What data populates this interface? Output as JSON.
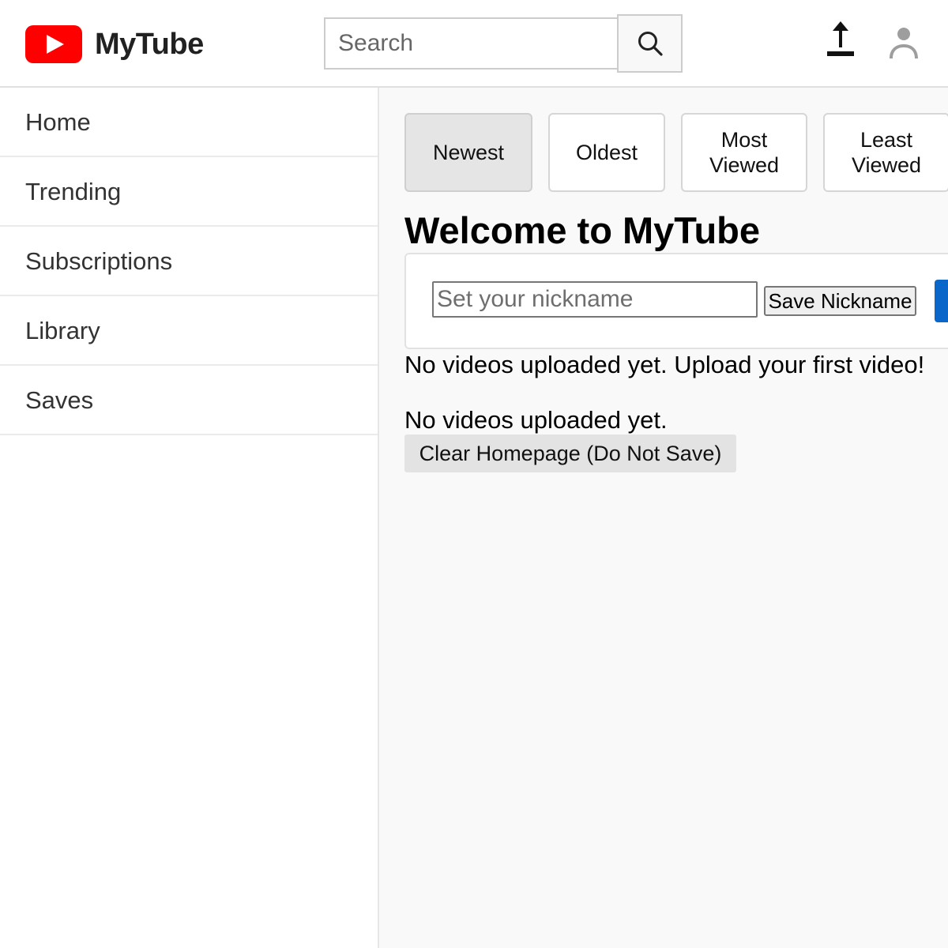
{
  "app": {
    "name": "MyTube",
    "brand_color": "#ff0000"
  },
  "header": {
    "logo_icon": "play-button-icon",
    "search": {
      "placeholder": "Search",
      "value": "",
      "button_icon": "search-icon"
    },
    "upload_icon": "upload-icon",
    "account_icon": "account-icon"
  },
  "sidebar": {
    "items": [
      {
        "label": "Home"
      },
      {
        "label": "Trending"
      },
      {
        "label": "Subscriptions"
      },
      {
        "label": "Library"
      },
      {
        "label": "Saves"
      }
    ]
  },
  "main": {
    "sort_options": [
      {
        "label": "Newest",
        "active": true
      },
      {
        "label": "Oldest",
        "active": false
      },
      {
        "label": "Most Viewed",
        "active": false
      },
      {
        "label": "Least Viewed",
        "active": false
      }
    ],
    "title": "Welcome to MyTube",
    "nickname": {
      "placeholder": "Set your nickname",
      "value": "",
      "save_label": "Save Nickname",
      "action_color": "#0b66c9"
    },
    "empty_message": "No videos uploaded yet. Upload your first video!",
    "empty_message_secondary": "No videos uploaded yet.",
    "clear_button_label": "Clear Homepage (Do Not Save)"
  }
}
